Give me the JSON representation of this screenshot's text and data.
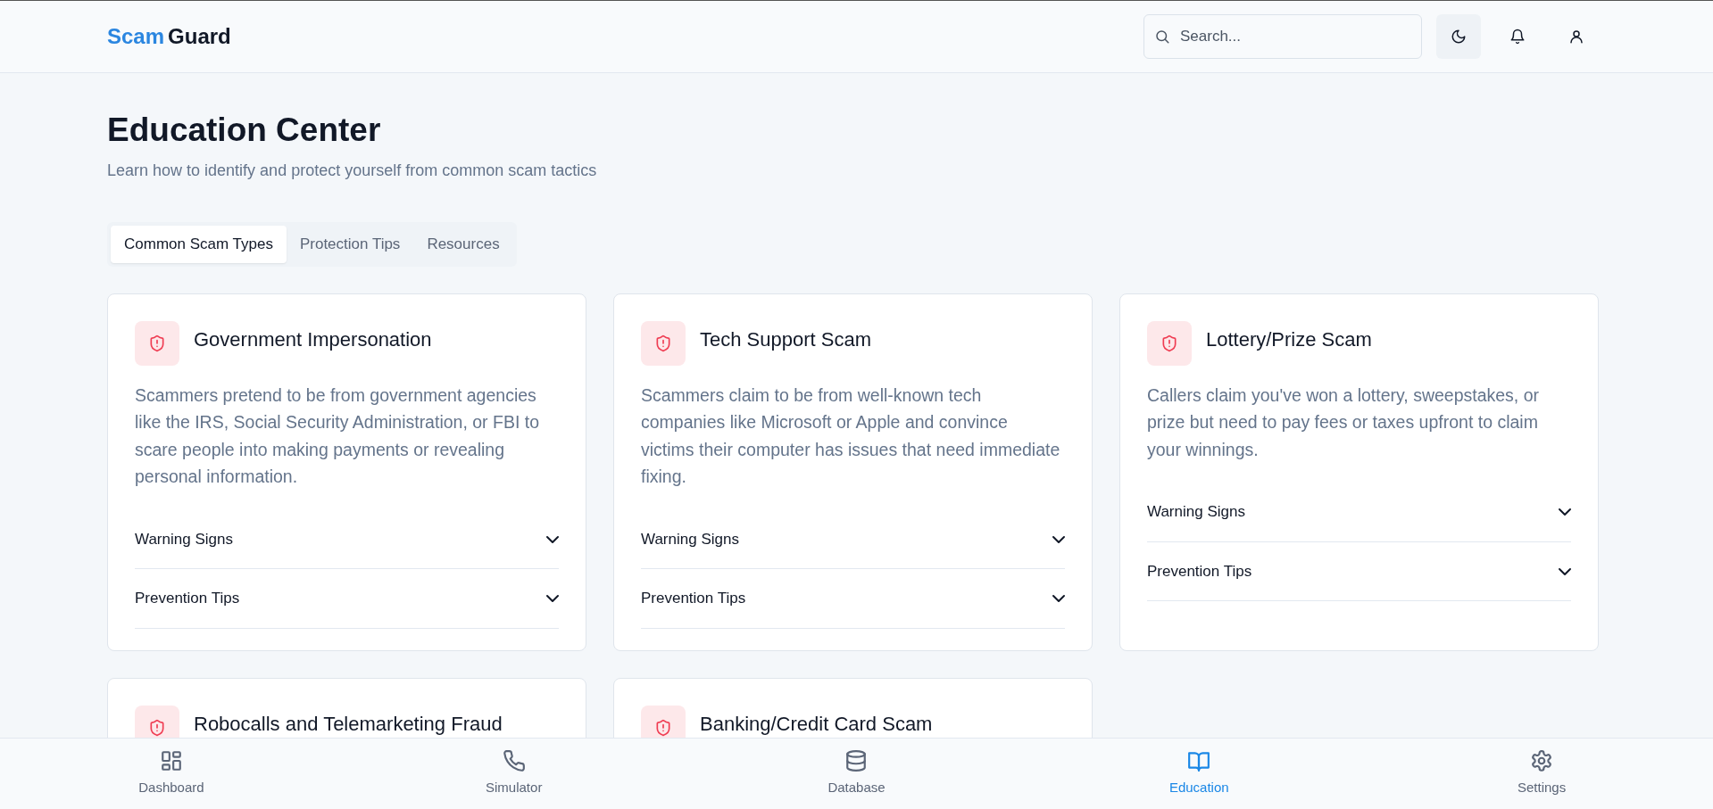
{
  "header": {
    "logo": {
      "first": "Scam",
      "second": "Guard"
    },
    "search": {
      "placeholder": "Search..."
    },
    "actions": [
      {
        "kind": "theme"
      },
      {
        "kind": "bell"
      },
      {
        "kind": "user"
      }
    ]
  },
  "page": {
    "title": "Education Center",
    "subtitle": "Learn how to identify and protect yourself from common scam tactics"
  },
  "tabs": [
    {
      "label": "Common Scam Types",
      "selected": true
    },
    {
      "label": "Protection Tips",
      "selected": false
    },
    {
      "label": "Resources",
      "selected": false
    }
  ],
  "cards": [
    {
      "title": "Government Impersonation",
      "description": "Scammers pretend to be from government agencies like the IRS, Social Security Administration, or FBI to scare people into making payments or revealing personal information.",
      "sections": [
        {
          "label": "Warning Signs",
          "expanded": false
        },
        {
          "label": "Prevention Tips",
          "expanded": false
        }
      ]
    },
    {
      "title": "Tech Support Scam",
      "description": "Scammers claim to be from well-known tech companies like Microsoft or Apple and convince victims their computer has issues that need immediate fixing.",
      "sections": [
        {
          "label": "Warning Signs",
          "expanded": false
        },
        {
          "label": "Prevention Tips",
          "expanded": false
        }
      ]
    },
    {
      "title": "Lottery/Prize Scam",
      "description": "Callers claim you've won a lottery, sweepstakes, or prize but need to pay fees or taxes upfront to claim your winnings.",
      "sections": [
        {
          "label": "Warning Signs",
          "expanded": false
        },
        {
          "label": "Prevention Tips",
          "expanded": false
        }
      ]
    },
    {
      "title": "Robocalls and Telemarketing Fraud"
    },
    {
      "title": "Banking/Credit Card Scam"
    }
  ],
  "bottom_nav": [
    {
      "kind": "dashboard",
      "label": "Dashboard",
      "selected": false
    },
    {
      "kind": "phone",
      "label": "Simulator",
      "selected": false
    },
    {
      "kind": "database",
      "label": "Database",
      "selected": false
    },
    {
      "kind": "book",
      "label": "Education",
      "selected": true
    },
    {
      "kind": "gear",
      "label": "Settings",
      "selected": false
    }
  ]
}
